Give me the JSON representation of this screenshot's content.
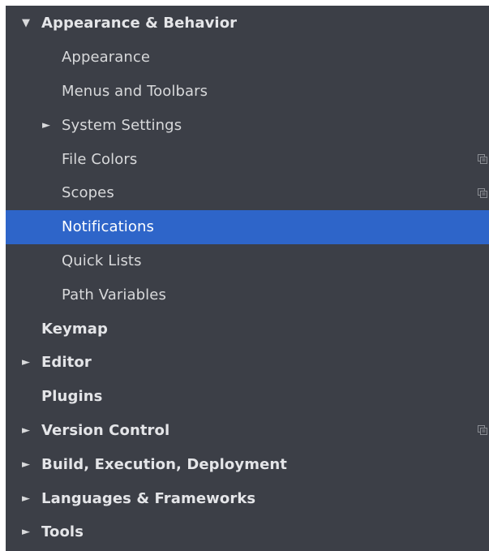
{
  "tree": {
    "items": [
      {
        "label": "Appearance & Behavior",
        "arrow": "▼"
      },
      {
        "label": "Appearance"
      },
      {
        "label": "Menus and Toolbars"
      },
      {
        "label": "System Settings",
        "arrow": "►"
      },
      {
        "label": "File Colors"
      },
      {
        "label": "Scopes"
      },
      {
        "label": "Notifications"
      },
      {
        "label": "Quick Lists"
      },
      {
        "label": "Path Variables"
      },
      {
        "label": "Keymap"
      },
      {
        "label": "Editor",
        "arrow": "►"
      },
      {
        "label": "Plugins"
      },
      {
        "label": "Version Control",
        "arrow": "►"
      },
      {
        "label": "Build, Execution, Deployment",
        "arrow": "►"
      },
      {
        "label": "Languages & Frameworks",
        "arrow": "►"
      },
      {
        "label": "Tools",
        "arrow": "►"
      }
    ]
  },
  "colors": {
    "background": "#3c3f47",
    "selection": "#2e65c9",
    "text": "#d8d9db"
  },
  "icons": {
    "project_scope": "copy-icon"
  }
}
